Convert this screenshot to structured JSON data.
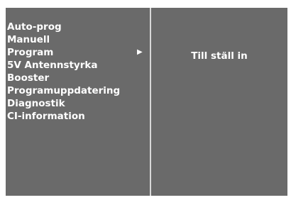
{
  "menu": {
    "items": [
      {
        "label": "Auto-prog"
      },
      {
        "label": "Manuell"
      },
      {
        "label": "Program",
        "arrow": "▶"
      },
      {
        "label": "5V Antennstyrka"
      },
      {
        "label": "Booster"
      },
      {
        "label": "Programuppdatering"
      },
      {
        "label": "Diagnostik"
      },
      {
        "label": "CI-information"
      }
    ]
  },
  "submenu": {
    "hint": "Till ställ in"
  },
  "colors": {
    "panel_background": "#6a6a6a",
    "divider": "#d8d8d8",
    "text": "#ffffff"
  }
}
